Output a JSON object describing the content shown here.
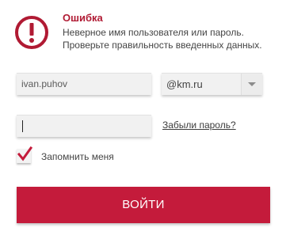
{
  "error": {
    "title": "Ошибка",
    "line1": "Неверное имя пользователя или пароль.",
    "line2": "Проверьте правильность введенных данных.",
    "icon": "exclamation-circle-icon",
    "color": "#b01a33"
  },
  "form": {
    "login_value": "ivan.puhov",
    "domain_value": "@km.ru",
    "password_value": "",
    "forgot_label": "Забыли пароль?",
    "remember_label": "Запомнить меня",
    "remember_checked": true,
    "submit_label": "ВОЙТИ"
  },
  "colors": {
    "accent": "#c41b3b",
    "field_bg": "#f1f1f1"
  }
}
